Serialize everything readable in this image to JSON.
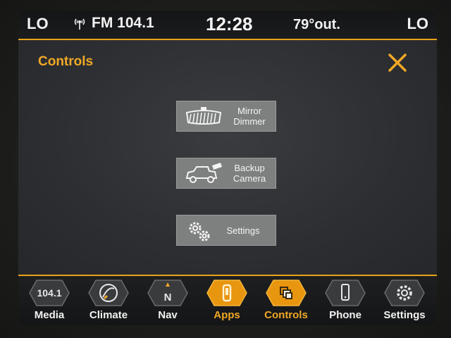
{
  "status_bar": {
    "left_fan": "LO",
    "radio": "FM 104.1",
    "time": "12:28",
    "temperature": "79°out.",
    "right_fan": "LO"
  },
  "page": {
    "title": "Controls"
  },
  "buttons": {
    "mirror_dimmer": "Mirror\nDimmer",
    "backup_camera": "Backup\nCamera",
    "settings": "Settings"
  },
  "nav": {
    "items": [
      {
        "label": "Media",
        "icon": "radio-preset-icon",
        "badge": "104.1"
      },
      {
        "label": "Climate",
        "icon": "climate-icon"
      },
      {
        "label": "Nav",
        "icon": "compass-icon",
        "badge": "N"
      },
      {
        "label": "Apps",
        "icon": "apps-icon"
      },
      {
        "label": "Controls",
        "icon": "controls-icon"
      },
      {
        "label": "Phone",
        "icon": "phone-icon"
      },
      {
        "label": "Settings",
        "icon": "gear-icon"
      }
    ],
    "active": [
      "Apps",
      "Controls"
    ]
  },
  "colors": {
    "accent": "#f0a826",
    "button_bg": "#7e7f7f",
    "screen_bg": "#2b2d31"
  }
}
